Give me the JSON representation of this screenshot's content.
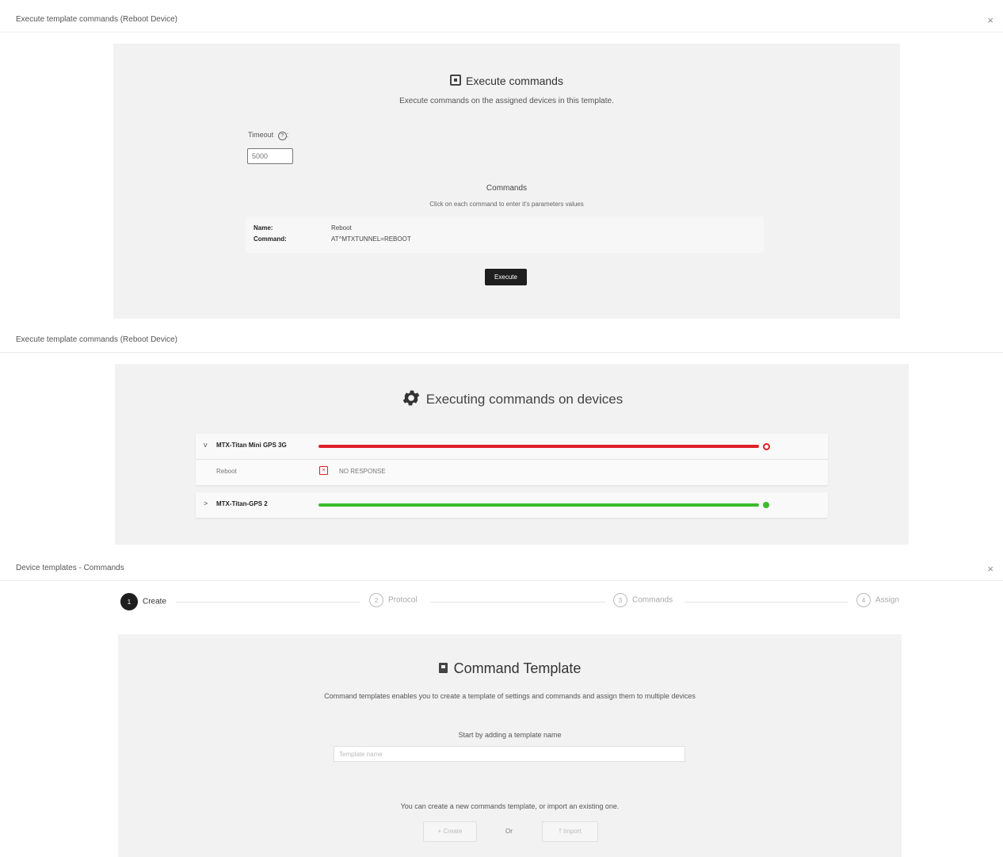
{
  "panel1": {
    "title": "Execute template commands (Reboot Device)",
    "close": "×",
    "heading": "Execute commands",
    "subheading": "Execute commands on the assigned devices in this template.",
    "timeout_label": "Timeout",
    "timeout_help": "?",
    "timeout_value": "5000",
    "commands_title": "Commands",
    "commands_sub": "Click on each command to enter it's parameters values",
    "command": {
      "name_key": "Name:",
      "name_val": "Reboot",
      "cmd_key": "Command:",
      "cmd_val": "AT^MTXTUNNEL=REBOOT"
    },
    "execute_label": "Execute"
  },
  "panel2": {
    "title": "Execute template commands (Reboot Device)",
    "heading": "Executing commands on devices",
    "devices": [
      {
        "name": "MTX-Titan Mini GPS 3G",
        "expanded": true,
        "status": "error",
        "chevron": "v"
      },
      {
        "name": "MTX-Titan-GPS 2",
        "expanded": false,
        "status": "success",
        "chevron": ">"
      }
    ],
    "sub_command": {
      "name": "Reboot",
      "result": "NO RESPONSE"
    },
    "colors": {
      "error": "#e0202a",
      "success": "#3cbc2c"
    }
  },
  "panel3": {
    "title": "Device templates - Commands",
    "close": "×",
    "steps": [
      {
        "num": "1",
        "label": "Create"
      },
      {
        "num": "2",
        "label": "Protocol"
      },
      {
        "num": "3",
        "label": "Commands"
      },
      {
        "num": "4",
        "label": "Assign"
      }
    ],
    "heading": "Command Template",
    "subheading": "Command templates enables you to create a template of settings and commands and assign them to multiple devices",
    "start_label": "Start by adding a template name",
    "name_placeholder": "Template name",
    "create_info": "You can create a new commands template, or import an existing one.",
    "create_label": "+ Create",
    "or_label": "Or",
    "import_label": "⤒ Import"
  }
}
